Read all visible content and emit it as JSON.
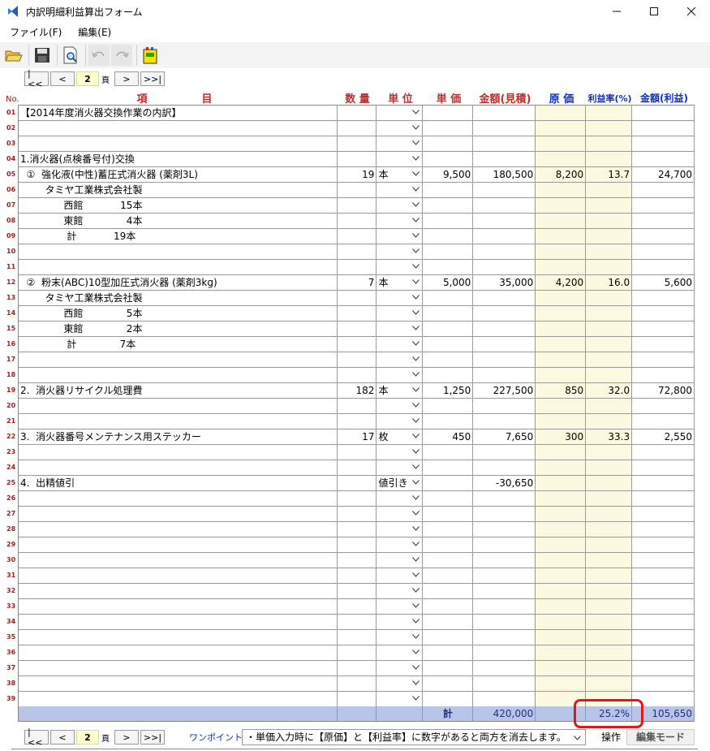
{
  "window": {
    "title": "内訳明細利益算出フォーム"
  },
  "menu": {
    "items": [
      "ファイル(F)",
      "編集(E)"
    ]
  },
  "pager": {
    "first": "|<<",
    "prev": "<",
    "page": "2",
    "unit": "頁",
    "next": ">",
    "last": ">>|"
  },
  "headers": {
    "no": "No.",
    "item_a": "項",
    "item_b": "目",
    "qty": "数 量",
    "unit": "単 位",
    "price": "単 価",
    "amount_est": "金額(見積)",
    "cost": "原 価",
    "margin": "利益率(%)",
    "amount_profit": "金額(利益)"
  },
  "rows": [
    {
      "no": "01",
      "item": "【2014年度消火器交換作業の内訳】",
      "qty": "",
      "unit": "",
      "price": "",
      "amount": "",
      "cost": "",
      "rate": "",
      "profit": ""
    },
    {
      "no": "02",
      "item": "",
      "qty": "",
      "unit": "",
      "price": "",
      "amount": "",
      "cost": "",
      "rate": "",
      "profit": ""
    },
    {
      "no": "03",
      "item": "",
      "qty": "",
      "unit": "",
      "price": "",
      "amount": "",
      "cost": "",
      "rate": "",
      "profit": ""
    },
    {
      "no": "04",
      "item": "1.消火器(点検番号付)交換",
      "qty": "",
      "unit": "",
      "price": "",
      "amount": "",
      "cost": "",
      "rate": "",
      "profit": ""
    },
    {
      "no": "05",
      "item": "  ①  強化液(中性)蓄圧式消火器 (薬剤3L)",
      "qty": "19",
      "unit": "本",
      "price": "9,500",
      "amount": "180,500",
      "cost": "8,200",
      "rate": "13.7",
      "profit": "24,700"
    },
    {
      "no": "06",
      "item": "        タミヤ工業株式会社製",
      "qty": "",
      "unit": "",
      "price": "",
      "amount": "",
      "cost": "",
      "rate": "",
      "profit": ""
    },
    {
      "no": "07",
      "item": "              西館            15本",
      "qty": "",
      "unit": "",
      "price": "",
      "amount": "",
      "cost": "",
      "rate": "",
      "profit": ""
    },
    {
      "no": "08",
      "item": "              東館              4本",
      "qty": "",
      "unit": "",
      "price": "",
      "amount": "",
      "cost": "",
      "rate": "",
      "profit": ""
    },
    {
      "no": "09",
      "item": "               計            19本",
      "qty": "",
      "unit": "",
      "price": "",
      "amount": "",
      "cost": "",
      "rate": "",
      "profit": ""
    },
    {
      "no": "10",
      "item": "",
      "qty": "",
      "unit": "",
      "price": "",
      "amount": "",
      "cost": "",
      "rate": "",
      "profit": ""
    },
    {
      "no": "11",
      "item": "",
      "qty": "",
      "unit": "",
      "price": "",
      "amount": "",
      "cost": "",
      "rate": "",
      "profit": ""
    },
    {
      "no": "12",
      "item": "  ②  粉末(ABC)10型加圧式消火器 (薬剤3kg)",
      "qty": "7",
      "unit": "本",
      "price": "5,000",
      "amount": "35,000",
      "cost": "4,200",
      "rate": "16.0",
      "profit": "5,600"
    },
    {
      "no": "13",
      "item": "        タミヤ工業株式会社製",
      "qty": "",
      "unit": "",
      "price": "",
      "amount": "",
      "cost": "",
      "rate": "",
      "profit": ""
    },
    {
      "no": "14",
      "item": "              西館              5本",
      "qty": "",
      "unit": "",
      "price": "",
      "amount": "",
      "cost": "",
      "rate": "",
      "profit": ""
    },
    {
      "no": "15",
      "item": "              東館              2本",
      "qty": "",
      "unit": "",
      "price": "",
      "amount": "",
      "cost": "",
      "rate": "",
      "profit": ""
    },
    {
      "no": "16",
      "item": "               計              7本",
      "qty": "",
      "unit": "",
      "price": "",
      "amount": "",
      "cost": "",
      "rate": "",
      "profit": ""
    },
    {
      "no": "17",
      "item": "",
      "qty": "",
      "unit": "",
      "price": "",
      "amount": "",
      "cost": "",
      "rate": "",
      "profit": ""
    },
    {
      "no": "18",
      "item": "",
      "qty": "",
      "unit": "",
      "price": "",
      "amount": "",
      "cost": "",
      "rate": "",
      "profit": ""
    },
    {
      "no": "19",
      "item": "2.  消火器リサイクル処理費",
      "qty": "182",
      "unit": "本",
      "price": "1,250",
      "amount": "227,500",
      "cost": "850",
      "rate": "32.0",
      "profit": "72,800"
    },
    {
      "no": "20",
      "item": "",
      "qty": "",
      "unit": "",
      "price": "",
      "amount": "",
      "cost": "",
      "rate": "",
      "profit": ""
    },
    {
      "no": "21",
      "item": "",
      "qty": "",
      "unit": "",
      "price": "",
      "amount": "",
      "cost": "",
      "rate": "",
      "profit": ""
    },
    {
      "no": "22",
      "item": "3.  消火器番号メンテナンス用ステッカー",
      "qty": "17",
      "unit": "枚",
      "price": "450",
      "amount": "7,650",
      "cost": "300",
      "rate": "33.3",
      "profit": "2,550"
    },
    {
      "no": "23",
      "item": "",
      "qty": "",
      "unit": "",
      "price": "",
      "amount": "",
      "cost": "",
      "rate": "",
      "profit": ""
    },
    {
      "no": "24",
      "item": "",
      "qty": "",
      "unit": "",
      "price": "",
      "amount": "",
      "cost": "",
      "rate": "",
      "profit": ""
    },
    {
      "no": "25",
      "item": "4.  出精値引",
      "qty": "",
      "unit": "値引き",
      "price": "",
      "amount": "-30,650",
      "cost": "",
      "rate": "",
      "profit": ""
    },
    {
      "no": "26",
      "item": "",
      "qty": "",
      "unit": "",
      "price": "",
      "amount": "",
      "cost": "",
      "rate": "",
      "profit": ""
    },
    {
      "no": "27",
      "item": "",
      "qty": "",
      "unit": "",
      "price": "",
      "amount": "",
      "cost": "",
      "rate": "",
      "profit": ""
    },
    {
      "no": "28",
      "item": "",
      "qty": "",
      "unit": "",
      "price": "",
      "amount": "",
      "cost": "",
      "rate": "",
      "profit": ""
    },
    {
      "no": "29",
      "item": "",
      "qty": "",
      "unit": "",
      "price": "",
      "amount": "",
      "cost": "",
      "rate": "",
      "profit": ""
    },
    {
      "no": "30",
      "item": "",
      "qty": "",
      "unit": "",
      "price": "",
      "amount": "",
      "cost": "",
      "rate": "",
      "profit": ""
    },
    {
      "no": "31",
      "item": "",
      "qty": "",
      "unit": "",
      "price": "",
      "amount": "",
      "cost": "",
      "rate": "",
      "profit": ""
    },
    {
      "no": "32",
      "item": "",
      "qty": "",
      "unit": "",
      "price": "",
      "amount": "",
      "cost": "",
      "rate": "",
      "profit": ""
    },
    {
      "no": "33",
      "item": "",
      "qty": "",
      "unit": "",
      "price": "",
      "amount": "",
      "cost": "",
      "rate": "",
      "profit": ""
    },
    {
      "no": "34",
      "item": "",
      "qty": "",
      "unit": "",
      "price": "",
      "amount": "",
      "cost": "",
      "rate": "",
      "profit": ""
    },
    {
      "no": "35",
      "item": "",
      "qty": "",
      "unit": "",
      "price": "",
      "amount": "",
      "cost": "",
      "rate": "",
      "profit": ""
    },
    {
      "no": "36",
      "item": "",
      "qty": "",
      "unit": "",
      "price": "",
      "amount": "",
      "cost": "",
      "rate": "",
      "profit": ""
    },
    {
      "no": "37",
      "item": "",
      "qty": "",
      "unit": "",
      "price": "",
      "amount": "",
      "cost": "",
      "rate": "",
      "profit": ""
    },
    {
      "no": "38",
      "item": "",
      "qty": "",
      "unit": "",
      "price": "",
      "amount": "",
      "cost": "",
      "rate": "",
      "profit": ""
    },
    {
      "no": "39",
      "item": "",
      "qty": "",
      "unit": "",
      "price": "",
      "amount": "",
      "cost": "",
      "rate": "",
      "profit": ""
    }
  ],
  "totals": {
    "label": "計",
    "amount": "420,000",
    "rate": "25.2%",
    "profit": "105,650"
  },
  "footer": {
    "onepoint_label": "ワンポイント:",
    "onepoint_text": "・単価入力時に【原価】と【利益率】に数字があると両方を消去します。",
    "op_label": "操作",
    "edit_mode": "編集モード"
  },
  "colors": {
    "highlight": "#e01818",
    "totals_bg": "#b8c4e8",
    "cost_bg": "#fbf9e0"
  }
}
